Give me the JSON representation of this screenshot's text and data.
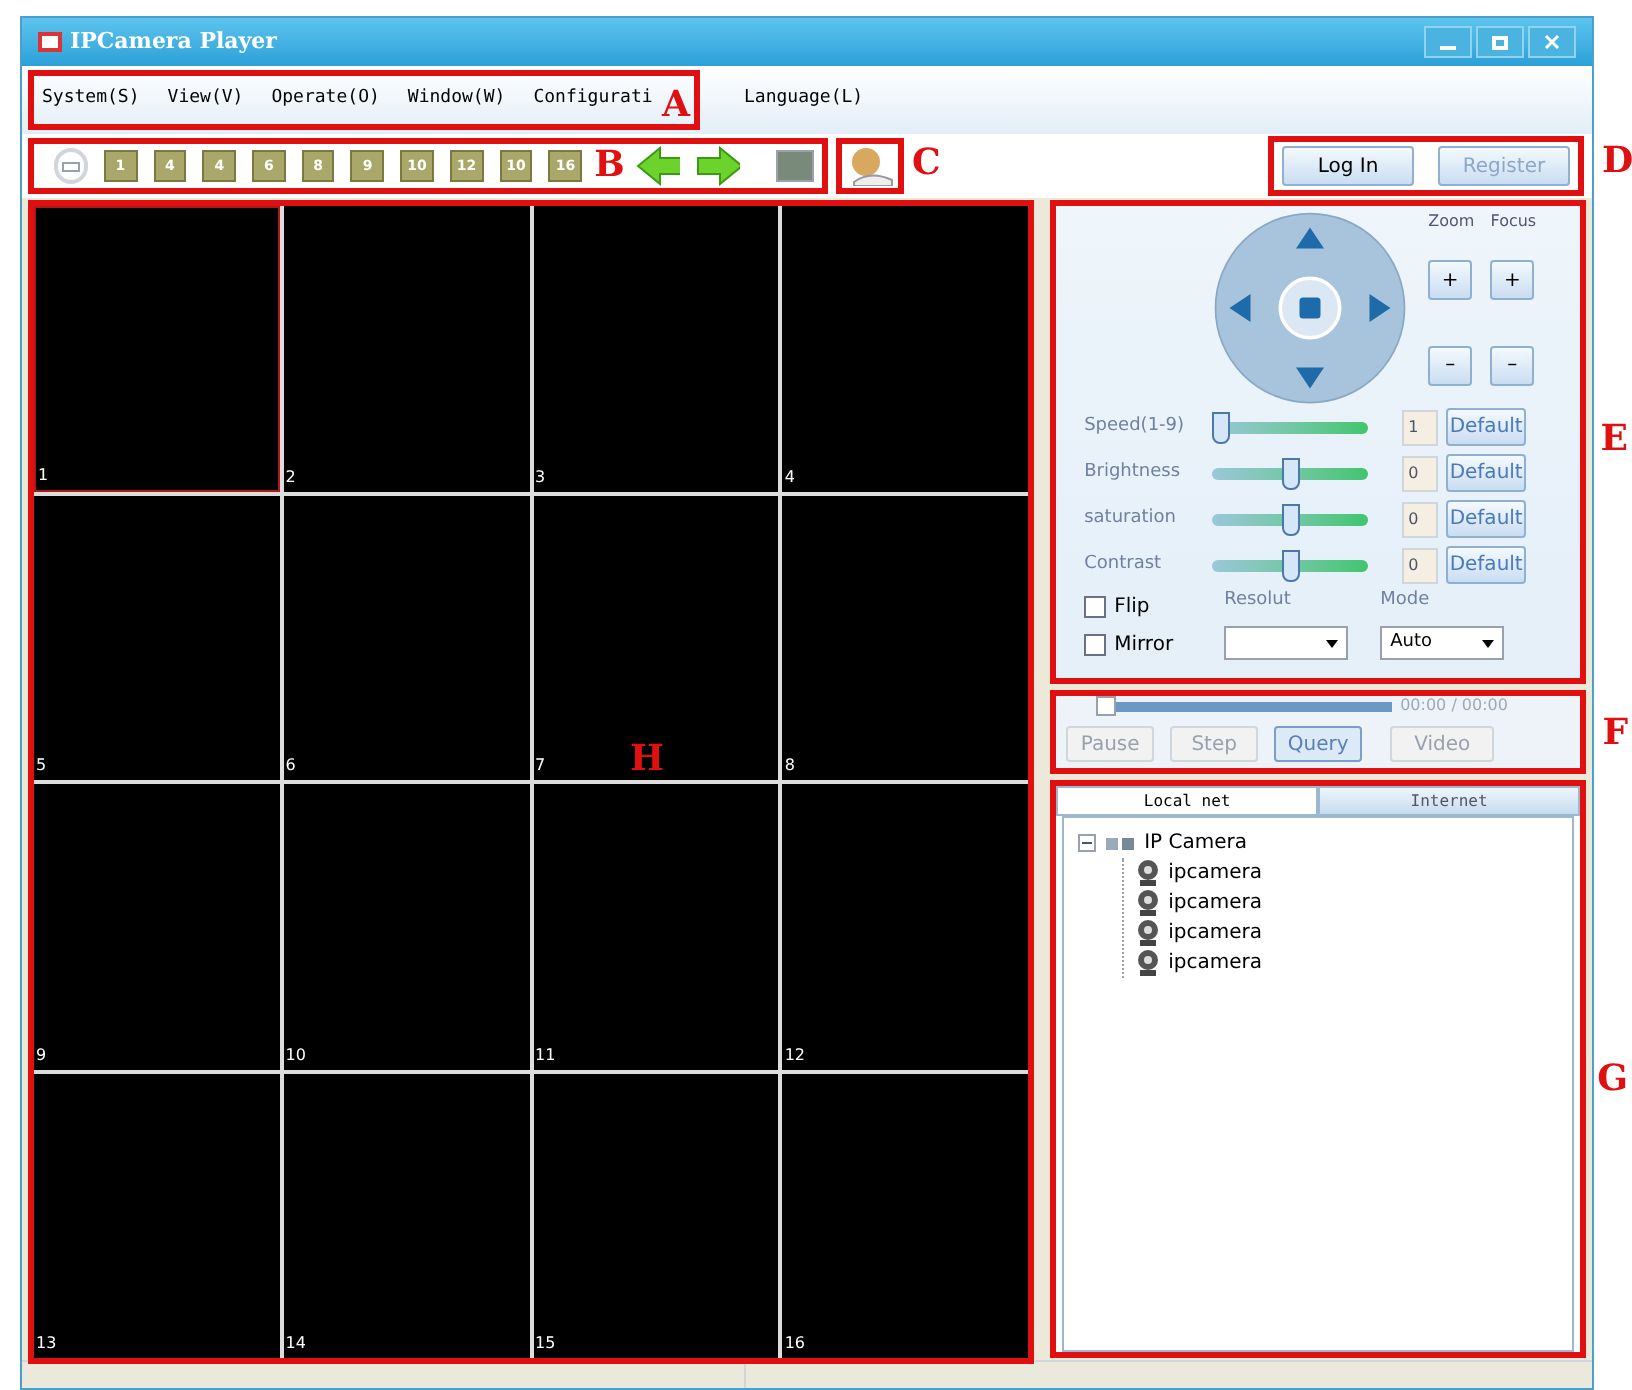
{
  "window": {
    "title": "IPCamera Player"
  },
  "menu": [
    {
      "label": "System(S)"
    },
    {
      "label": "View(V)"
    },
    {
      "label": "Operate(O)"
    },
    {
      "label": "Window(W)"
    },
    {
      "label": "Configurati"
    },
    {
      "label": "Language(L)"
    }
  ],
  "toolbar": {
    "layouts": [
      "1",
      "4",
      "4",
      "6",
      "8",
      "9",
      "10",
      "12",
      "10",
      "16"
    ]
  },
  "account_buttons": [
    {
      "label": "Log In",
      "disabled": false
    },
    {
      "label": "Register",
      "disabled": true
    }
  ],
  "ptz": {
    "zoom_label": "Zoom",
    "focus_label": "Focus",
    "plus": "+",
    "minus": "–"
  },
  "adjustments": [
    {
      "label": "Speed(1-9)",
      "level": 0,
      "value": "1",
      "button": "Default"
    },
    {
      "label": "Brightness",
      "level": 0.5,
      "value": "0",
      "button": "Default"
    },
    {
      "label": "saturation",
      "level": 0.5,
      "value": "0",
      "button": "Default"
    },
    {
      "label": "Contrast",
      "level": 0.5,
      "value": "0",
      "button": "Default"
    }
  ],
  "options": {
    "checkboxes": [
      {
        "label": "Flip",
        "checked": false
      },
      {
        "label": "Mirror",
        "checked": false
      }
    ],
    "resolution_label": "Resolut",
    "mode_label": "Mode",
    "mode_value": "Auto"
  },
  "playback": {
    "level": 0,
    "time": "00:00 / 00:00",
    "buttons": [
      {
        "label": "Pause",
        "selected": false
      },
      {
        "label": "Step",
        "selected": false
      },
      {
        "label": "Query",
        "selected": true
      },
      {
        "label": "Video",
        "selected": false
      }
    ]
  },
  "device_tabs": [
    {
      "label": "Local net",
      "selected": true
    },
    {
      "label": "Internet",
      "selected": false
    }
  ],
  "device_tree": [
    {
      "label": "IP Camera",
      "expanded": true,
      "children": [
        {
          "label": "ipcamera"
        },
        {
          "label": "ipcamera"
        },
        {
          "label": "ipcamera"
        },
        {
          "label": "ipcamera"
        }
      ]
    }
  ],
  "video_grid": [
    {
      "label": "1",
      "selected": true
    },
    {
      "label": "2",
      "selected": false
    },
    {
      "label": "3",
      "selected": false
    },
    {
      "label": "4",
      "selected": false
    },
    {
      "label": "5",
      "selected": false
    },
    {
      "label": "6",
      "selected": false
    },
    {
      "label": "7",
      "selected": false
    },
    {
      "label": "8",
      "selected": false
    },
    {
      "label": "9",
      "selected": false
    },
    {
      "label": "10",
      "selected": false
    },
    {
      "label": "11",
      "selected": false
    },
    {
      "label": "12",
      "selected": false
    },
    {
      "label": "13",
      "selected": false
    },
    {
      "label": "14",
      "selected": false
    },
    {
      "label": "15",
      "selected": false
    },
    {
      "label": "16",
      "selected": false
    }
  ],
  "annotations": [
    "A",
    "B",
    "C",
    "D",
    "E",
    "F",
    "G",
    "H"
  ]
}
